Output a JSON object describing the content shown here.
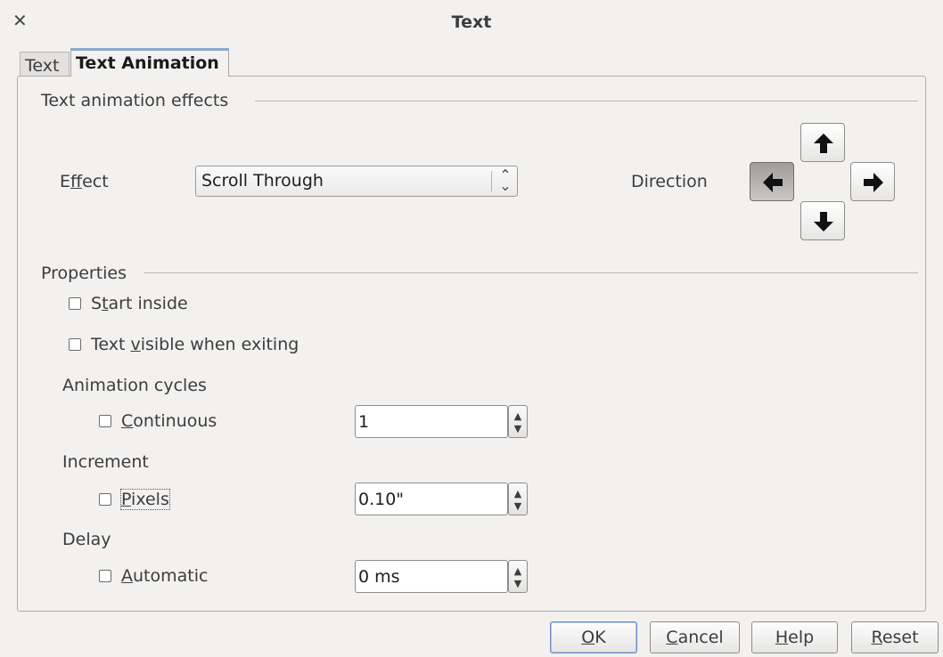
{
  "window": {
    "title": "Text"
  },
  "tabs": [
    {
      "label": "Text",
      "selected": false
    },
    {
      "label": "Text Animation",
      "selected": true
    }
  ],
  "effects_section": {
    "header": "Text animation effects",
    "effect_label_pre": "E",
    "effect_label_mnemonic": "f",
    "effect_label_post": "fect",
    "effect_value": "Scroll Through",
    "direction_label": "Direction",
    "direction_selected": "left"
  },
  "properties_section": {
    "header": "Properties",
    "start_inside": {
      "pre": "S",
      "mnemonic": "t",
      "post": "art inside",
      "checked": false
    },
    "text_visible": {
      "pre": "Text ",
      "mnemonic": "v",
      "post": "isible when exiting",
      "checked": false
    },
    "animation_cycles": {
      "header": "Animation cycles",
      "checkbox": {
        "pre": "",
        "mnemonic": "C",
        "post": "ontinuous",
        "checked": false
      },
      "value": "1"
    },
    "increment": {
      "header": "Increment",
      "checkbox": {
        "pre": "",
        "mnemonic": "P",
        "post": "ixels",
        "checked": false
      },
      "value": "0.10\""
    },
    "delay": {
      "header": "Delay",
      "checkbox": {
        "pre": "",
        "mnemonic": "A",
        "post": "utomatic",
        "checked": false
      },
      "value": "0 ms"
    }
  },
  "buttons": {
    "ok": {
      "mnemonic": "O",
      "post": "K"
    },
    "cancel": {
      "mnemonic": "C",
      "post": "ancel"
    },
    "help": {
      "mnemonic": "H",
      "post": "elp"
    },
    "reset": {
      "mnemonic": "R",
      "post": "eset"
    }
  }
}
